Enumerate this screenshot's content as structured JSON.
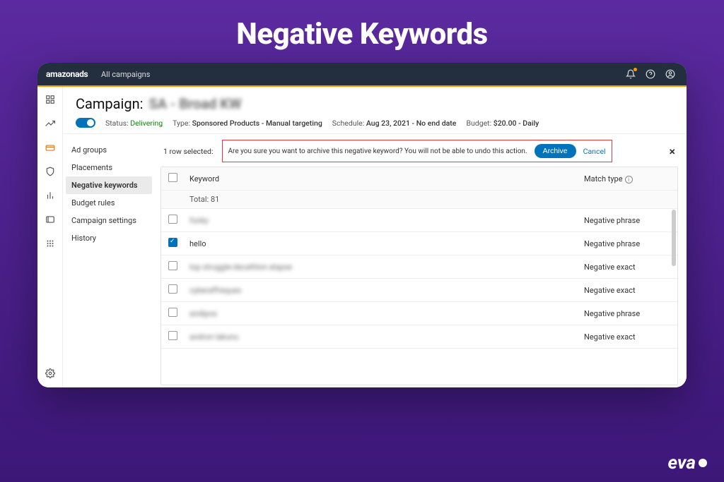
{
  "hero": {
    "title": "Negative Keywords"
  },
  "topbar": {
    "brand": "amazonads",
    "nav_all_campaigns": "All campaigns"
  },
  "campaign": {
    "title_prefix": "Campaign:",
    "title_blurred": "SA - Broad KW",
    "status_label": "Status:",
    "status_value": "Delivering",
    "type_label": "Type:",
    "type_value": "Sponsored Products - Manual targeting",
    "schedule_label": "Schedule:",
    "schedule_value": "Aug 23, 2021 - No end date",
    "budget_label": "Budget:",
    "budget_value": "$20.00 - Daily"
  },
  "sidenav": {
    "items": [
      {
        "label": "Ad groups"
      },
      {
        "label": "Placements"
      },
      {
        "label": "Negative keywords",
        "active": true
      },
      {
        "label": "Budget rules"
      },
      {
        "label": "Campaign settings"
      },
      {
        "label": "History"
      }
    ]
  },
  "actionbar": {
    "selected_text": "1 row selected:",
    "confirm_msg": "Are you sure you want to archive this negative keyword? You will not be able to undo this action.",
    "archive_label": "Archive",
    "cancel_label": "Cancel"
  },
  "table": {
    "col_keyword": "Keyword",
    "col_match": "Match type",
    "total_label": "Total: 81",
    "rows": [
      {
        "checked": false,
        "keyword": "funky",
        "blurred": true,
        "match": "Negative phrase"
      },
      {
        "checked": true,
        "keyword": "hello",
        "blurred": false,
        "match": "Negative phrase"
      },
      {
        "checked": false,
        "keyword": "top struggle-decathlon elapse",
        "blurred": true,
        "match": "Negative exact"
      },
      {
        "checked": false,
        "keyword": "cyberaffreques",
        "blurred": true,
        "match": "Negative exact"
      },
      {
        "checked": false,
        "keyword": "andipos",
        "blurred": true,
        "match": "Negative phrase"
      },
      {
        "checked": false,
        "keyword": "andron lakunu",
        "blurred": true,
        "match": "Negative exact"
      }
    ]
  },
  "watermark": {
    "text": "eva"
  }
}
